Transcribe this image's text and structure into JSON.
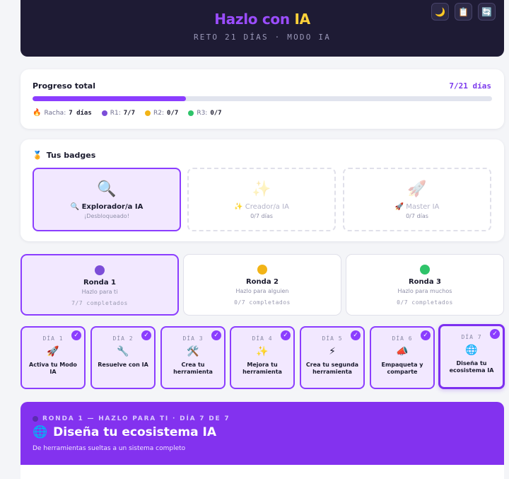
{
  "header": {
    "title_main": "Hazlo con ",
    "title_highlight": "IA",
    "subtitle": "RETO 21 DÍAS · MODO IA",
    "buttons": [
      {
        "icon": "🌙",
        "name": "moon-icon"
      },
      {
        "icon": "📋",
        "name": "clipboard-icon"
      },
      {
        "icon": "🔄",
        "name": "refresh-icon"
      }
    ]
  },
  "progress": {
    "label": "Progreso total",
    "value_text": "7/21 días",
    "fraction": 0.3333,
    "streak_label": "Racha:",
    "streak_value": "7 días",
    "r1_label": "R1:",
    "r1_value": "7/7",
    "r2_label": "R2:",
    "r2_value": "0/7",
    "r3_label": "R3:",
    "r3_value": "0/7"
  },
  "badges": {
    "title": "Tus badges",
    "title_icon": "🏅",
    "items": [
      {
        "icon": "🔍",
        "name": "🔍 Explorador/a IA",
        "status": "¡Desbloqueado!"
      },
      {
        "icon": "✨",
        "name": "✨ Creador/a IA",
        "status": "0/7 días"
      },
      {
        "icon": "🚀",
        "name": "🚀 Master IA",
        "status": "0/7 días"
      }
    ]
  },
  "rounds": [
    {
      "name": "Ronda 1",
      "sub": "Hazlo para ti",
      "done": "7/7 completados",
      "color": "#7c4dd8"
    },
    {
      "name": "Ronda 2",
      "sub": "Hazlo para alguien",
      "done": "0/7 completados",
      "color": "#f2b417"
    },
    {
      "name": "Ronda 3",
      "sub": "Hazlo para muchos",
      "done": "0/7 completados",
      "color": "#2fc46a"
    }
  ],
  "days": [
    {
      "num": "DÍA 1",
      "icon": "🚀",
      "label": "Activa tu Modo IA"
    },
    {
      "num": "DÍA 2",
      "icon": "🔧",
      "label": "Resuelve con IA"
    },
    {
      "num": "DÍA 3",
      "icon": "🛠️",
      "label": "Crea tu herramienta"
    },
    {
      "num": "DÍA 4",
      "icon": "✨",
      "label": "Mejora tu herramienta"
    },
    {
      "num": "DÍA 5",
      "icon": "⚡",
      "label": "Crea tu segunda herramienta"
    },
    {
      "num": "DÍA 6",
      "icon": "📣",
      "label": "Empaqueta y comparte"
    },
    {
      "num": "DÍA 7",
      "icon": "🌐",
      "label": "Diseña tu ecosistema IA"
    }
  ],
  "check_mark": "✓",
  "current_day": {
    "kicker": "RONDA 1 — HAZLO PARA TI · DÍA 7 DE 7",
    "icon": "🌐",
    "title": "Diseña tu ecosistema IA",
    "subtitle": "De herramientas sueltas a un sistema completo"
  }
}
